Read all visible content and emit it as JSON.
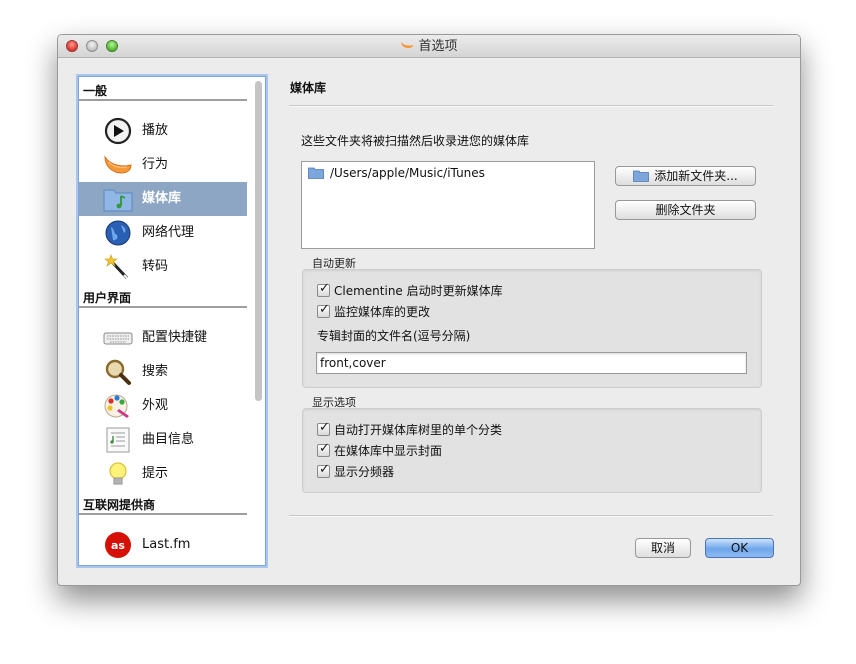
{
  "window": {
    "title": "首选项"
  },
  "sidebar": {
    "sections": [
      {
        "label": "一般"
      },
      {
        "label": "用户界面"
      },
      {
        "label": "互联网提供商"
      }
    ],
    "items": [
      {
        "label": "播放",
        "icon": "play-icon"
      },
      {
        "label": "行为",
        "icon": "clementine-icon"
      },
      {
        "label": "媒体库",
        "icon": "music-folder-icon",
        "selected": true
      },
      {
        "label": "网络代理",
        "icon": "globe-icon"
      },
      {
        "label": "转码",
        "icon": "magic-wand-icon"
      },
      {
        "label": "配置快捷键",
        "icon": "keyboard-icon"
      },
      {
        "label": "搜索",
        "icon": "magnifier-icon"
      },
      {
        "label": "外观",
        "icon": "palette-icon"
      },
      {
        "label": "曲目信息",
        "icon": "track-info-icon"
      },
      {
        "label": "提示",
        "icon": "lightbulb-icon"
      },
      {
        "label": "Last.fm",
        "icon": "lastfm-icon"
      }
    ]
  },
  "main": {
    "title": "媒体库",
    "description": "这些文件夹将被扫描然后收录进您的媒体库",
    "folders": [
      "/Users/apple/Music/iTunes"
    ],
    "add_folder_label": "添加新文件夹...",
    "remove_folder_label": "删除文件夹",
    "auto_update": {
      "label": "自动更新",
      "startup_update": {
        "label": "Clementine 启动时更新媒体库",
        "checked": true
      },
      "monitor_changes": {
        "label": "监控媒体库的更改",
        "checked": true
      },
      "cover_filename_label": "专辑封面的文件名(逗号分隔)",
      "cover_filename_value": "front,cover"
    },
    "display_options": {
      "label": "显示选项",
      "auto_open_single": {
        "label": "自动打开媒体库树里的单个分类",
        "checked": true
      },
      "show_covers": {
        "label": "在媒体库中显示封面",
        "checked": true
      },
      "show_dividers": {
        "label": "显示分频器",
        "checked": true
      }
    }
  },
  "footer": {
    "cancel_label": "取消",
    "ok_label": "OK"
  },
  "colors": {
    "selection": "#8da6c4",
    "primary_button": "#6fa6ec",
    "window_bg": "#ececec"
  }
}
